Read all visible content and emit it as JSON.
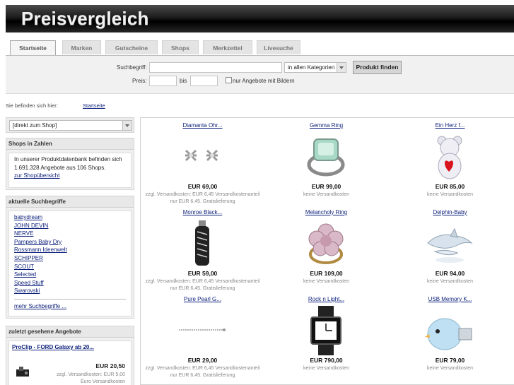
{
  "header": {
    "logo": "Preisvergleich"
  },
  "tabs": [
    "Startseite",
    "Marken",
    "Gutscheine",
    "Shops",
    "Merkzettel",
    "Livesuche"
  ],
  "search": {
    "label": "Suchbegriff:",
    "category": "in allen Kategorien",
    "button": "Produkt finden",
    "price_label": "Preis:",
    "price_to": "bis",
    "images_only": "nur Angebote mit Bildern"
  },
  "breadcrumb": {
    "label": "Sie befinden sich hier:",
    "link": "Startseite"
  },
  "sidebar": {
    "shop_select": "[direkt zum Shop]",
    "stats": {
      "title": "Shops in Zahlen",
      "line1": "In unserer Produktdatenbank befinden sich",
      "line2": "1.691.328 Angebote aus 106 Shops.",
      "link": "zur Shopübersicht"
    },
    "searches": {
      "title": "aktuelle Suchbegriffe",
      "items": [
        "babydream",
        "JOHN DEVIN",
        "NERVE",
        "Pampers Baby Dry",
        "Rossmann Ideenwelt",
        "SCHIPPER",
        "SCOUT",
        "Selected",
        "Speed Stuff",
        "Swarovski"
      ],
      "more": "mehr Suchbegriffe ..."
    },
    "recent": {
      "title": "zuletzt gesehene Angebote",
      "item_name": "ProClip - FORD Galaxy ab 20...",
      "item_price": "EUR 20,50",
      "item_ship1": "zzgl. Versandkosten: EUR 5,00",
      "item_ship2": "Euro Versandkosten"
    }
  },
  "products": [
    {
      "name": "Diamanta Ohr...",
      "price": "EUR 69,00",
      "ship1": "zzgl. Versandkosten: EUR 6,45 Versandkostenanteil",
      "ship2": "nur EUR 6,45. Gratislieferung",
      "icon": "earrings-icon"
    },
    {
      "name": "Gemma Ring",
      "price": "EUR 99,00",
      "ship1": "keine Versandkosten",
      "ship2": "",
      "icon": "ring-icon"
    },
    {
      "name": "Ein Herz f...",
      "price": "EUR 85,00",
      "ship1": "keine Versandkosten",
      "ship2": "",
      "icon": "teddy-bear-icon"
    },
    {
      "name": "Monroe Black...",
      "price": "EUR 59,00",
      "ship1": "zzgl. Versandkosten: EUR 6,45 Versandkostenanteil",
      "ship2": "nur EUR 6,45. Gratislieferung",
      "icon": "usb-stick-icon"
    },
    {
      "name": "Melancholy Ring",
      "price": "EUR 109,00",
      "ship1": "keine Versandkosten",
      "ship2": "",
      "icon": "flower-ring-icon"
    },
    {
      "name": "Delphin-Baby",
      "price": "EUR 94,00",
      "ship1": "keine Versandkosten",
      "ship2": "",
      "icon": "dolphin-icon"
    },
    {
      "name": "Pure Pearl G...",
      "price": "EUR 29,00",
      "ship1": "zzgl. Versandkosten: EUR 6,45 Versandkostenanteil",
      "ship2": "nur EUR 6,45. Gratislieferung",
      "icon": "bracelet-icon"
    },
    {
      "name": "Rock n Light...",
      "price": "EUR 790,00",
      "ship1": "keine Versandkosten",
      "ship2": "",
      "icon": "watch-icon"
    },
    {
      "name": "USB Memory K...",
      "price": "EUR 79,00",
      "ship1": "keine Versandkosten",
      "ship2": "",
      "icon": "bird-usb-icon"
    }
  ],
  "colors": {
    "link": "#0b1f7a",
    "header_bg": "#000000",
    "panel_bg": "#f1f1f1"
  }
}
